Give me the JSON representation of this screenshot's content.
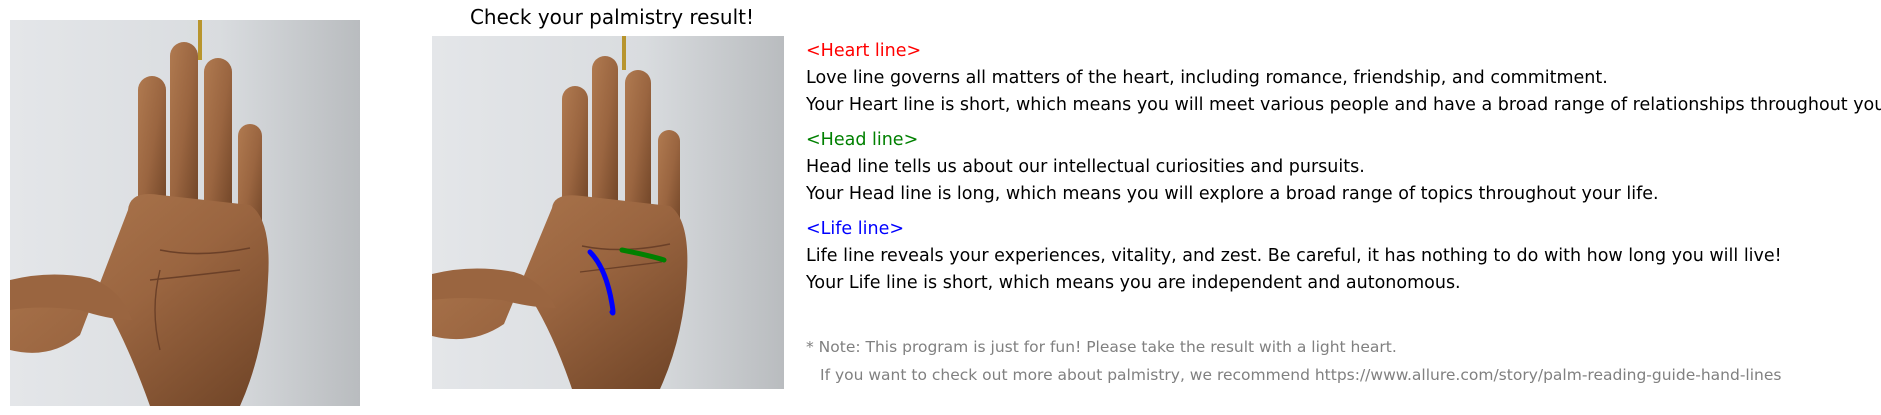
{
  "title": "Check your palmistry result!",
  "colors": {
    "heart": "#ff0000",
    "head": "#008000",
    "life": "#0000ff",
    "note": "#808080"
  },
  "sections": [
    {
      "key": "heart",
      "heading": "<Heart line>",
      "line1": "Love line governs all matters of the heart, including romance, friendship, and commitment.",
      "line2": "Your Heart line is short, which means you will meet various people and have a broad range of relationships throughout your life."
    },
    {
      "key": "head",
      "heading": "<Head line>",
      "line1": "Head line tells us about our intellectual curiosities and pursuits.",
      "line2": "Your Head line is long, which means you will explore a broad range of topics throughout your life."
    },
    {
      "key": "life",
      "heading": "<Life line>",
      "line1": "Life line reveals your experiences, vitality, and zest. Be careful, it has nothing to do with how long you will live!",
      "line2": "Your Life line is short, which means you are independent and autonomous."
    }
  ],
  "note": {
    "line1": "* Note: This program is just for fun! Please take the result with a light heart.",
    "line2": "If you want to check out more about palmistry, we recommend https://www.allure.com/story/palm-reading-guide-hand-lines"
  }
}
